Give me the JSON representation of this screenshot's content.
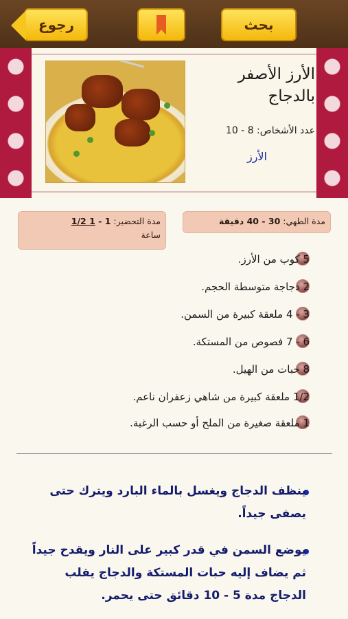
{
  "toolbar": {
    "back_label": "رجوع",
    "search_label": "بحث"
  },
  "recipe": {
    "title": "الأرز الأصفر بالدجاج",
    "servings": "عدد الأشخاص: 8 - 10",
    "category": "الأرز",
    "cook_time_label": "مدة الطهي:",
    "cook_time_value": "30 - 40 دقيقة",
    "prep_time_label": "مدة التحضير:",
    "prep_time_value_a": "1 - ",
    "prep_time_value_b": "1 1/2",
    "prep_time_unit": "ساعة"
  },
  "ingredients": [
    "5 كوب من الأرز.",
    "2 دجاجة متوسطة الحجم.",
    "3 - 4 ملعقة كبيرة من السمن.",
    "6 - 7 فصوص من المستكة.",
    "8 حبات من الهيل.",
    "1/2 ملعقة كبيرة من شاهي زعفران ناعم.",
    "1 ملعقة صغيرة من الملح أو حسب الرغبة."
  ],
  "steps": [
    "ينظف الدجاج ويغسل بالماء البارد ويترك حتى يصفى جيداً.",
    "يوضع السمن في قدر كبير على النار ويقدح جيداً ثم يضاف إليه حبات المستكة والدجاج يقلب الدجاج مدة 5 - 10 دقائق حتى يحمر."
  ],
  "colors": {
    "accent_ornament": "#b01a3e",
    "button_yellow": "#f7c61c",
    "topbar_brown": "#5c3b1e",
    "step_text": "#141c6c"
  }
}
